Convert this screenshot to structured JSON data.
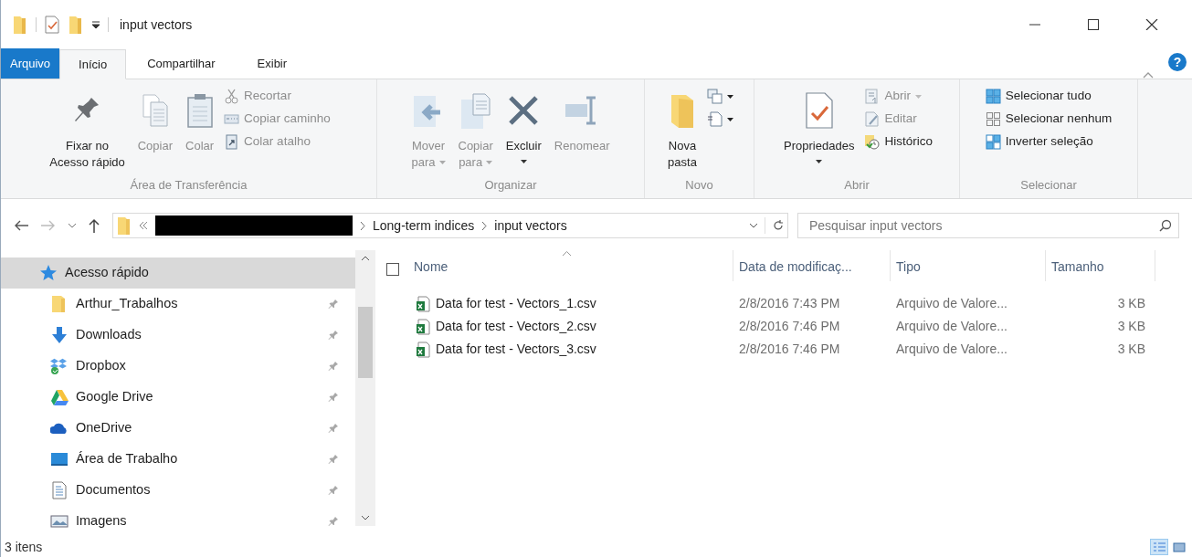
{
  "window": {
    "title": "input vectors",
    "help": "?"
  },
  "ribbon_tabs": [
    {
      "label": "Arquivo",
      "kind": "file",
      "selected": false
    },
    {
      "label": "Início",
      "kind": "tab",
      "selected": true
    },
    {
      "label": "Compartilhar",
      "kind": "tab",
      "selected": false
    },
    {
      "label": "Exibir",
      "kind": "tab",
      "selected": false
    }
  ],
  "ribbon_groups": [
    {
      "label": "Área de Transferência",
      "items": [
        {
          "kind": "large",
          "lines": [
            "Fixar no",
            "Acesso rápido"
          ],
          "disabled": false,
          "dropdown": false
        },
        {
          "kind": "large",
          "lines": [
            "Copiar"
          ],
          "disabled": true,
          "dropdown": false
        },
        {
          "kind": "large",
          "lines": [
            "Colar"
          ],
          "disabled": true,
          "dropdown": false
        },
        {
          "kind": "stack",
          "commands": [
            {
              "label": "Recortar",
              "disabled": true,
              "dropdown": false
            },
            {
              "label": "Copiar caminho",
              "disabled": true,
              "dropdown": false
            },
            {
              "label": "Colar atalho",
              "disabled": true,
              "dropdown": false
            }
          ]
        }
      ]
    },
    {
      "label": "Organizar",
      "items": [
        {
          "kind": "large",
          "lines": [
            "Mover",
            "para"
          ],
          "disabled": true,
          "dropdown": true
        },
        {
          "kind": "large",
          "lines": [
            "Copiar",
            "para"
          ],
          "disabled": true,
          "dropdown": true
        },
        {
          "kind": "large",
          "lines": [
            "Excluir"
          ],
          "disabled": false,
          "dropdown": true
        },
        {
          "kind": "large",
          "lines": [
            "Renomear"
          ],
          "disabled": true,
          "dropdown": false
        }
      ]
    },
    {
      "label": "Novo",
      "items": [
        {
          "kind": "large",
          "lines": [
            "Nova",
            "pasta"
          ],
          "disabled": false,
          "dropdown": false
        },
        {
          "kind": "stack",
          "commands": [
            {
              "disabled": false,
              "dropdown": true
            },
            {
              "disabled": false,
              "dropdown": true
            }
          ]
        }
      ]
    },
    {
      "label": "Abrir",
      "items": [
        {
          "kind": "large",
          "lines": [
            "Propriedades"
          ],
          "disabled": false,
          "dropdown": true
        },
        {
          "kind": "stack",
          "commands": [
            {
              "label": "Abrir",
              "disabled": true,
              "dropdown": true
            },
            {
              "label": "Editar",
              "disabled": true,
              "dropdown": false
            },
            {
              "label": "Histórico",
              "disabled": false,
              "dropdown": false
            }
          ]
        }
      ]
    },
    {
      "label": "Selecionar",
      "items": [
        {
          "kind": "stack",
          "commands": [
            {
              "label": "Selecionar tudo",
              "disabled": false,
              "dropdown": false
            },
            {
              "label": "Selecionar nenhum",
              "disabled": false,
              "dropdown": false
            },
            {
              "label": "Inverter seleção",
              "disabled": false,
              "dropdown": false
            }
          ]
        }
      ]
    }
  ],
  "address_bar": {
    "crumbs": [
      "Long-term indices",
      "input vectors"
    ]
  },
  "search": {
    "placeholder": "Pesquisar input vectors"
  },
  "nav_tree": [
    {
      "label": "Acesso rápido",
      "selected": true,
      "children": [
        {
          "label": "Arthur_Trabalhos",
          "pinned": true,
          "selected": false
        },
        {
          "label": "Downloads",
          "pinned": true,
          "selected": false
        },
        {
          "label": "Dropbox",
          "pinned": true,
          "selected": false
        },
        {
          "label": "Google Drive",
          "pinned": true,
          "selected": false
        },
        {
          "label": "OneDrive",
          "pinned": true,
          "selected": false
        },
        {
          "label": "Área de Trabalho",
          "pinned": true,
          "selected": false
        },
        {
          "label": "Documentos",
          "pinned": true,
          "selected": false
        },
        {
          "label": "Imagens",
          "pinned": true,
          "selected": false
        }
      ]
    }
  ],
  "file_list": {
    "select_all_checked": false,
    "columns": [
      {
        "label": "Nome",
        "sorted": true
      },
      {
        "label": "Data de modificaç...",
        "sorted": false
      },
      {
        "label": "Tipo",
        "sorted": false
      },
      {
        "label": "Tamanho",
        "sorted": false
      }
    ],
    "rows": [
      {
        "name": "Data for test - Vectors_1.csv",
        "date": "2/8/2016 7:43 PM",
        "type": "Arquivo de Valore...",
        "size": "3 KB"
      },
      {
        "name": "Data for test - Vectors_2.csv",
        "date": "2/8/2016 7:46 PM",
        "type": "Arquivo de Valore...",
        "size": "3 KB"
      },
      {
        "name": "Data for test - Vectors_3.csv",
        "date": "2/8/2016 7:46 PM",
        "type": "Arquivo de Valore...",
        "size": "3 KB"
      }
    ]
  },
  "status_bar": {
    "text": "3 itens",
    "view_buttons": [
      {
        "selected": true
      },
      {
        "selected": false
      }
    ]
  }
}
